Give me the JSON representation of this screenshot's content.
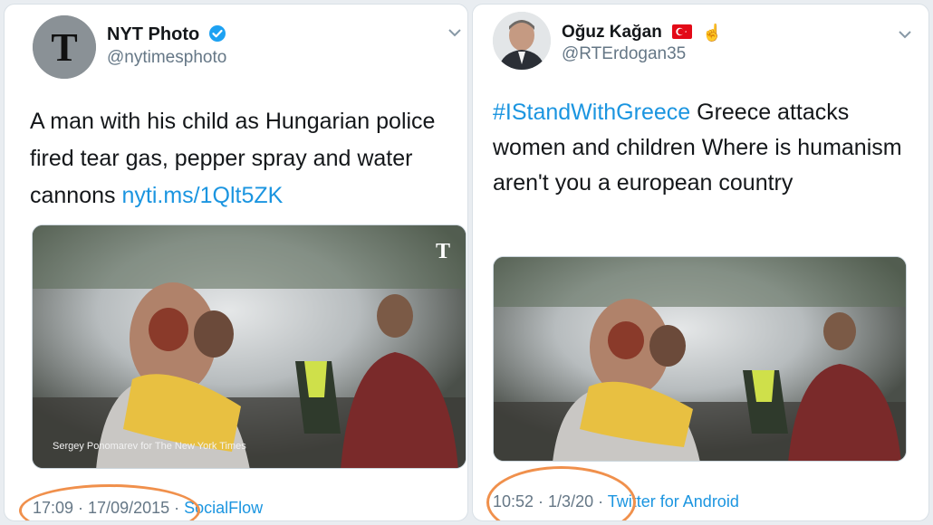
{
  "colors": {
    "link": "#1b95e0",
    "muted": "#657786",
    "verified": "#1da1f2",
    "annotation": "#f0904c"
  },
  "tweets": [
    {
      "display_name": "NYT Photo",
      "verified": true,
      "handle": "@nytimesphoto",
      "text": "A man with his child as Hungarian police fired tear gas, pepper spray and water cannons ",
      "link": "nyti.ms/1Qlt5ZK",
      "photo_credit": "Sergey Ponomarev for The New York Times",
      "time": "17:09 · 17/09/2015 · ",
      "app": "SocialFlow",
      "icons": [
        "nyt-logo-icon",
        "verified-badge-icon",
        "chevron-down-icon"
      ]
    },
    {
      "display_name": "Oğuz Kağan",
      "handle": "@RTErdogan35",
      "hashtag": "#IStandWithGreece",
      "text": " Greece attacks women and children Where is humanism aren't you a european country",
      "time": "10:52 · 1/3/20 · ",
      "app": "Twitter for Android",
      "icons": [
        "turkey-flag-icon",
        "pointing-up-hand-icon",
        "chevron-down-icon"
      ]
    }
  ]
}
